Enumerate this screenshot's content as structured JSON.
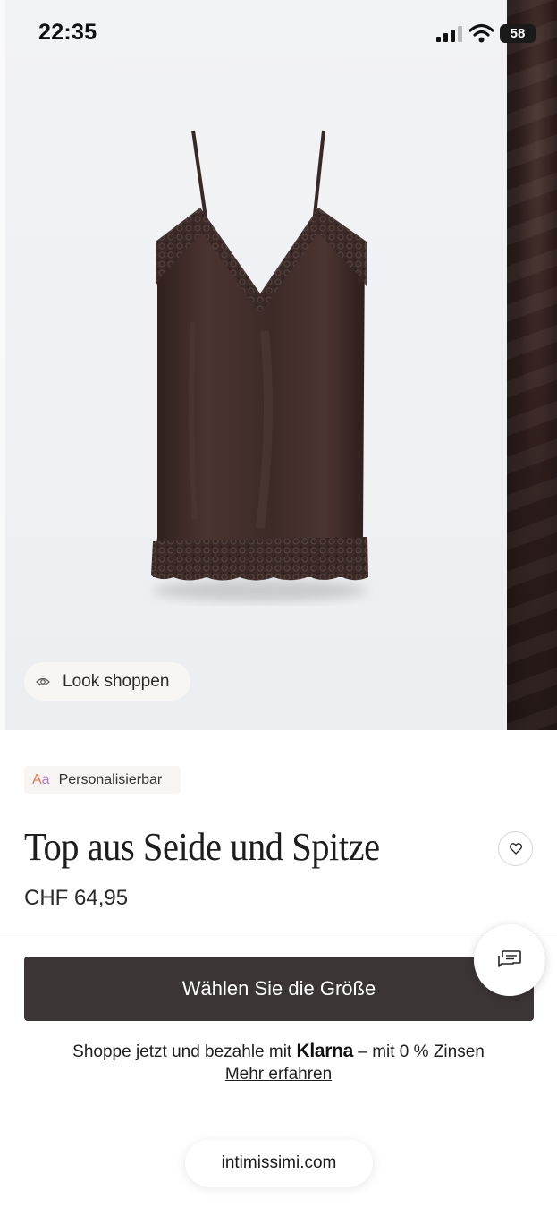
{
  "status_bar": {
    "time": "22:35",
    "battery": "58"
  },
  "gallery": {
    "look_button_label": "Look shoppen",
    "look_icon": "eye-icon"
  },
  "product": {
    "badge_icon_text": "Aa",
    "badge_label": "Personalisierbar",
    "title": "Top aus Seide und Spitze",
    "price": "CHF 64,95",
    "favorite_icon": "heart-icon"
  },
  "actions": {
    "size_button_label": "Wählen Sie die Größe",
    "chat_icon": "chat-icon"
  },
  "klarna": {
    "prefix": "Shoppe jetzt und bezahle mit",
    "brand": "Klarna",
    "suffix": "– mit 0 % Zinsen",
    "link_label": "Mehr erfahren"
  },
  "browser": {
    "url": "intimissimi.com"
  },
  "colors": {
    "button_bg": "#3b3536",
    "product_fabric": "#3e2a27",
    "badge_bg": "#f7f4f1"
  }
}
